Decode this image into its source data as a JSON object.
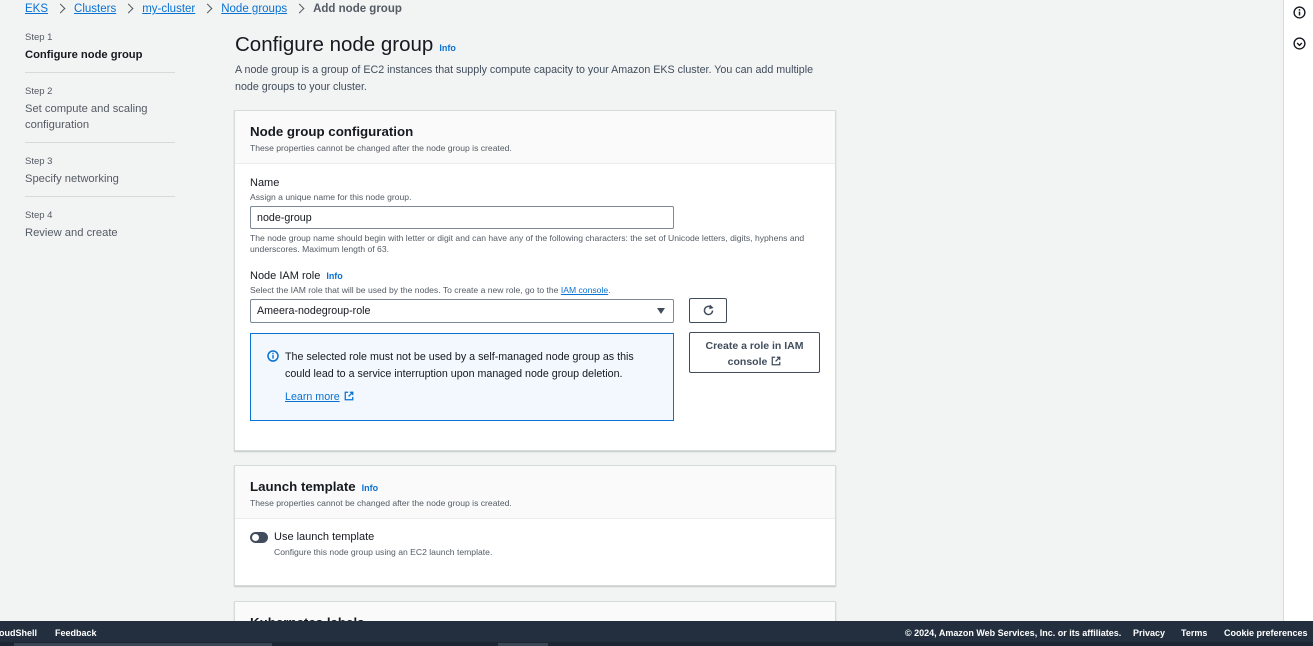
{
  "breadcrumb": {
    "items": [
      "EKS",
      "Clusters",
      "my-cluster",
      "Node groups"
    ],
    "current": "Add node group"
  },
  "steps": [
    {
      "num": "Step 1",
      "title": "Configure node group"
    },
    {
      "num": "Step 2",
      "title": "Set compute and scaling configuration"
    },
    {
      "num": "Step 3",
      "title": "Specify networking"
    },
    {
      "num": "Step 4",
      "title": "Review and create"
    }
  ],
  "page": {
    "title": "Configure node group",
    "info": "Info",
    "description": "A node group is a group of EC2 instances that supply compute capacity to your Amazon EKS cluster. You can add multiple node groups to your cluster."
  },
  "node_group_config": {
    "title": "Node group configuration",
    "subtitle": "These properties cannot be changed after the node group is created.",
    "name_label": "Name",
    "name_desc": "Assign a unique name for this node group.",
    "name_value": "node-group",
    "name_constraint": "The node group name should begin with letter or digit and can have any of the following characters: the set of Unicode letters, digits, hyphens and underscores. Maximum length of 63.",
    "role_label": "Node IAM role",
    "role_info": "Info",
    "role_desc": "Select the IAM role that will be used by the nodes. To create a new role, go to the",
    "role_desc_link": "IAM console",
    "role_desc_end": ".",
    "role_value": "Ameera-nodegroup-role",
    "alert_text": "The selected role must not be used by a self-managed node group as this could lead to a service interruption upon managed node group deletion.",
    "alert_link": "Learn more",
    "create_role_button": "Create a role in IAM console"
  },
  "launch_template": {
    "title": "Launch template",
    "info": "Info",
    "subtitle": "These properties cannot be changed after the node group is created.",
    "toggle_label": "Use launch template",
    "toggle_on": false,
    "toggle_desc": "Configure this node group using an EC2 launch template."
  },
  "next_panel": {
    "title": "Kubernetes labels"
  },
  "footer": {
    "cloudshell": "CloudShell",
    "feedback": "Feedback",
    "copyright": "© 2024, Amazon Web Services, Inc. or its affiliates.",
    "privacy": "Privacy",
    "terms": "Terms",
    "cookies": "Cookie preferences"
  },
  "icons": {
    "rail_top": "info-circle-icon",
    "rail_second": "notifications-icon",
    "refresh": "refresh-icon",
    "external": "external-link-icon",
    "alert": "info-circle-icon"
  },
  "colors": {
    "link": "#0972d3",
    "footer_bg": "#232f3e",
    "page_bg": "#f2f3f3",
    "alert_bg": "#f2f8fd"
  }
}
